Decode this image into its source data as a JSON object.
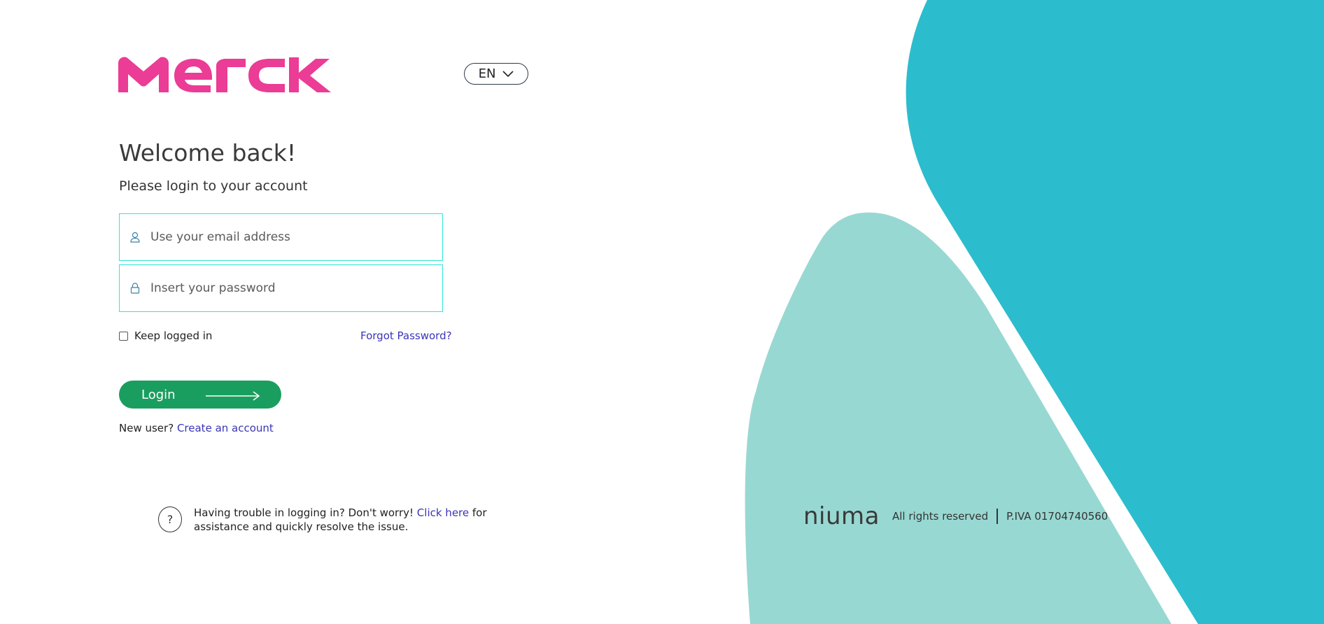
{
  "brand": {
    "logo_text": "MERCK",
    "logo_color": "#eb3c96"
  },
  "language": {
    "selected": "EN"
  },
  "login": {
    "heading": "Welcome back!",
    "subtitle": "Please login to your account",
    "email_placeholder": "Use your email address",
    "password_placeholder": "Insert your password",
    "keep_logged_label": "Keep logged in",
    "forgot_password": "Forgot Password?",
    "login_button": "Login",
    "new_user_text": "New user?",
    "create_account": "Create an account"
  },
  "help": {
    "text_before": "Having trouble in logging in? Don't worry!",
    "link": "Click here",
    "text_after": "for assistance and quickly resolve the issue."
  },
  "footer": {
    "brand": "niuma",
    "rights": "All rights reserved",
    "piva": "P.IVA 01704740560"
  },
  "colors": {
    "accent_pink": "#eb3c96",
    "teal_dark": "#2bbdcd",
    "teal_light": "#98d8d2",
    "button_green": "#1a9e5f",
    "field_border": "#2ee8d2",
    "link": "#3a35b8"
  },
  "icons": {
    "email": "user-icon",
    "password": "lock-icon",
    "language": "chevron-down-icon",
    "login": "arrow-right-icon",
    "help": "question-icon"
  }
}
